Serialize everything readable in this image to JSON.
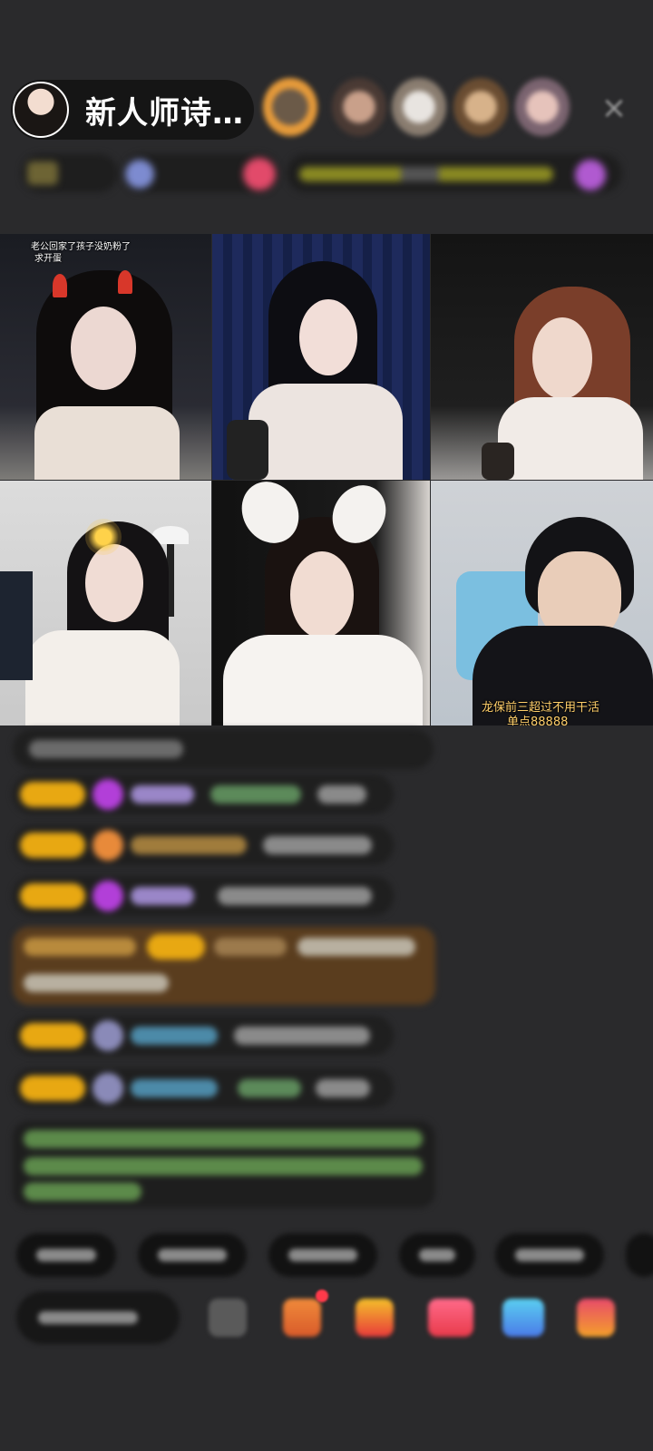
{
  "host": {
    "name": "新人师诗…",
    "avatar_icon": "host-avatar-icon"
  },
  "close_icon": "×",
  "grid": {
    "tile1_caption_line1": "老公回家了孩子没奶粉了",
    "tile1_caption_line2": "求开蛋",
    "tile6_caption_line1": "龙保前三超过不用干活",
    "tile6_caption_line2": "单点88888"
  },
  "colors": {
    "background": "#2a2a2c",
    "level_badge": "#e8a812",
    "caption": "#ffcf6a"
  }
}
